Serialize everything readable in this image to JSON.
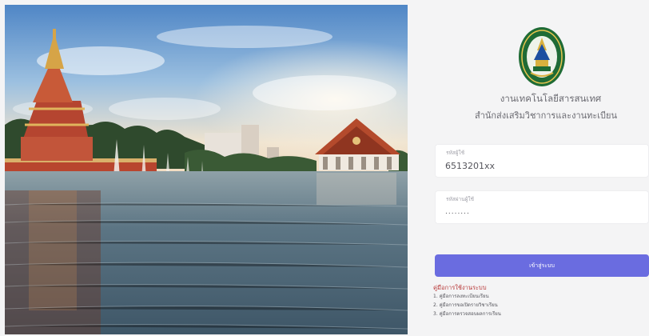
{
  "hero": {
    "image_description_icon": "campus-pond-photo"
  },
  "header": {
    "org_title": "งานเทคโนโลยีสารสนเทศ",
    "org_subtitle": "สำนักส่งเสริมวิชาการและงานทะเบียน"
  },
  "login": {
    "username_label": "รหัสผู้ใช้",
    "username_value": "6513201xx",
    "password_label": "รหัสผ่านผู้ใช้",
    "password_value": "........",
    "submit_label": "เข้าสู่ระบบ"
  },
  "manual": {
    "title": "คู่มือการใช้งานระบบ",
    "items": [
      "1. คู่มือการลงทะเบียนเรียน",
      "2. คู่มือการขอเปิดรายวิชาเรียน",
      "3. คู่มือการตรวจสอบผลการเรียน"
    ]
  },
  "colors": {
    "accent": "#6a6ce0",
    "manual_title": "#b83a3a",
    "logo_green": "#1f6b35"
  }
}
